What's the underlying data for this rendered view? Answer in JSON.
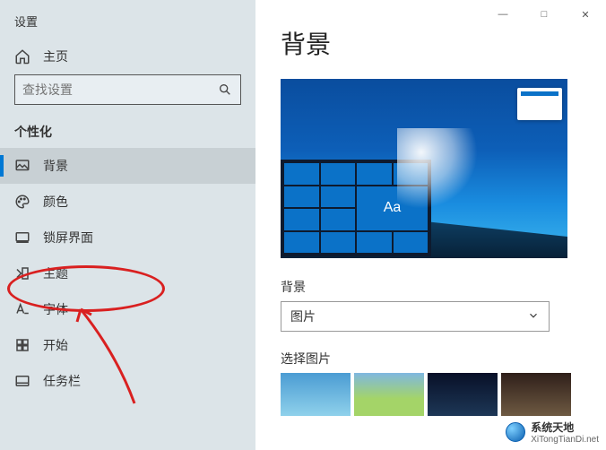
{
  "app_title": "设置",
  "titlebar": {
    "minimize": "—",
    "maximize": "□",
    "close": "✕"
  },
  "sidebar": {
    "home_label": "主页",
    "search_placeholder": "查找设置",
    "section_label": "个性化",
    "items": [
      {
        "label": "背景",
        "active": true
      },
      {
        "label": "颜色",
        "active": false
      },
      {
        "label": "锁屏界面",
        "active": false
      },
      {
        "label": "主题",
        "active": false
      },
      {
        "label": "字体",
        "active": false
      },
      {
        "label": "开始",
        "active": false
      },
      {
        "label": "任务栏",
        "active": false
      }
    ]
  },
  "main": {
    "page_title": "背景",
    "preview_aa": "Aa",
    "background_label": "背景",
    "background_select_value": "图片",
    "choose_picture_label": "选择图片"
  },
  "watermark": {
    "name": "系统天地",
    "url": "XiTongTianDi.net"
  }
}
